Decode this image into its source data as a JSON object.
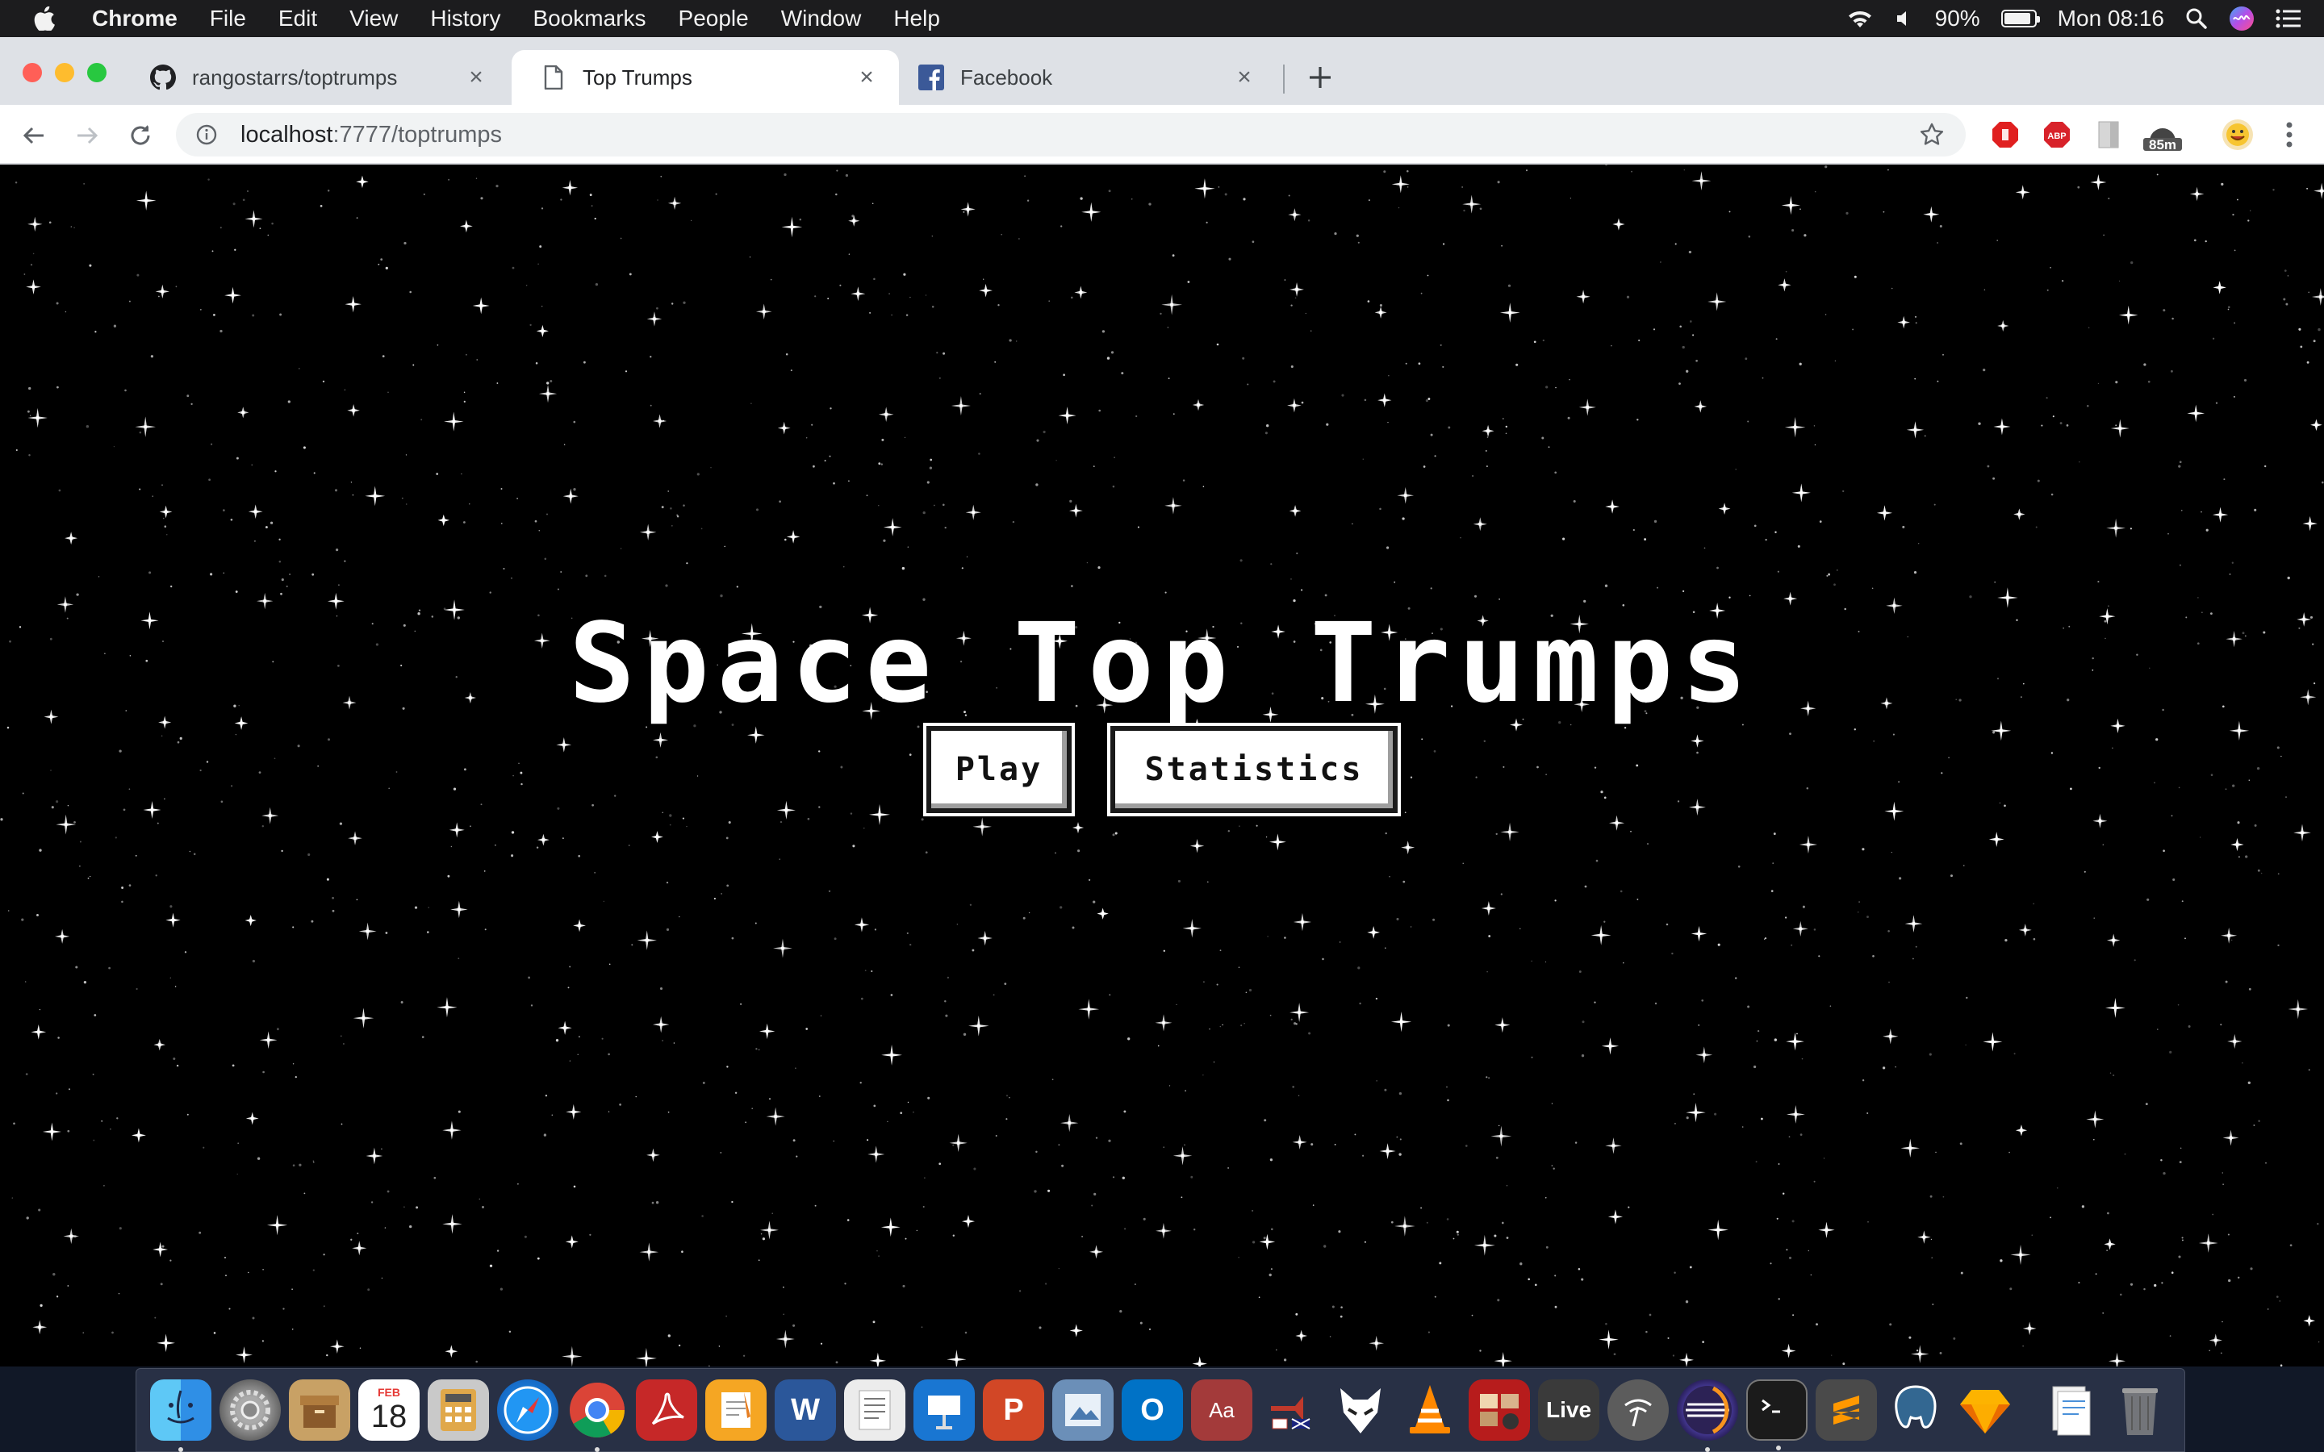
{
  "menubar": {
    "apple_icon": "apple-logo-icon",
    "app_name": "Chrome",
    "items": [
      "File",
      "Edit",
      "View",
      "History",
      "Bookmarks",
      "People",
      "Window",
      "Help"
    ],
    "battery_percent": "90%",
    "battery_level": 0.9,
    "clock": "Mon 08:16"
  },
  "tabs": [
    {
      "title": "rangostarrs/toptrumps",
      "icon": "github-icon",
      "active": false
    },
    {
      "title": "Top Trumps",
      "icon": "document-icon",
      "active": true
    },
    {
      "title": "Facebook",
      "icon": "facebook-icon",
      "active": false
    }
  ],
  "toolbar": {
    "url_host": "localhost",
    "url_path": ":7777/toptrumps",
    "extension_badge": "85m"
  },
  "page": {
    "title": "Space Top Trumps",
    "play_label": "Play",
    "statistics_label": "Statistics"
  },
  "dock": {
    "calendar_month": "FEB",
    "calendar_day": "18",
    "word_letter": "W",
    "powerpoint_letter": "P",
    "outlook_letter": "O",
    "dictionary_label": "Aa",
    "live_label": "Live",
    "apps": [
      "finder",
      "system-preferences",
      "archive-utility",
      "calendar",
      "calculator",
      "safari",
      "chrome",
      "acrobat",
      "pages",
      "word",
      "textedit",
      "keynote",
      "powerpoint",
      "preview",
      "outlook",
      "dictionary",
      "translator",
      "foxit",
      "vlc",
      "photo-booth",
      "ableton-live",
      "wifi-diagnostics",
      "eclipse",
      "terminal",
      "sublime-text",
      "postgresql",
      "sketch",
      "documents",
      "trash"
    ]
  },
  "colors": {
    "menubar_bg": "#1c1c1e",
    "tabstrip_bg": "#dee1e6",
    "page_bg": "#000000",
    "button_bg": "#ffffff",
    "close_red": "#ff5f57",
    "minimize_yellow": "#febc2e",
    "zoom_green": "#28c840"
  }
}
